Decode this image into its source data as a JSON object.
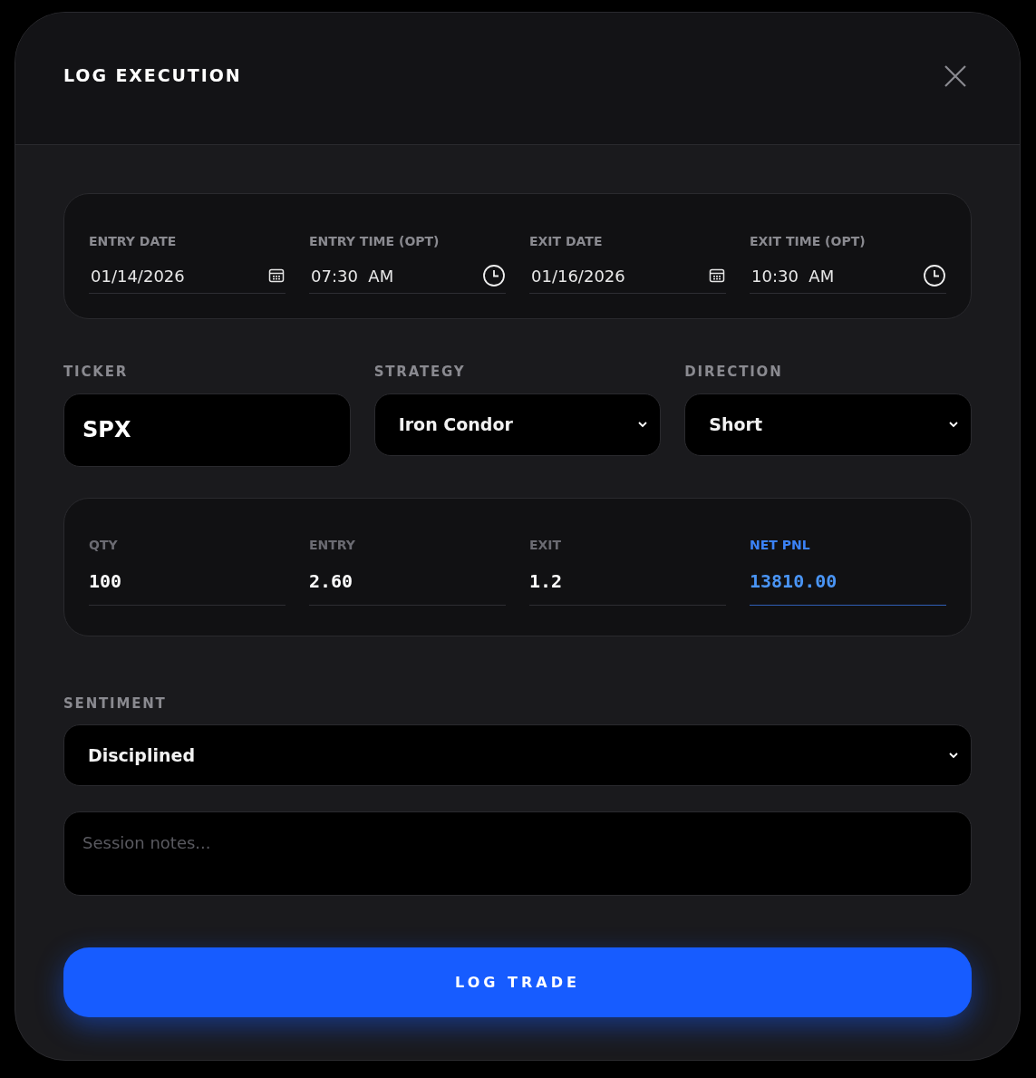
{
  "dialog": {
    "title": "LOG EXECUTION"
  },
  "timing": [
    {
      "label": "ENTRY DATE",
      "value": "01/14/2026",
      "kind": "date"
    },
    {
      "label": "ENTRY TIME (OPT)",
      "value": "07:30  AM",
      "kind": "time"
    },
    {
      "label": "EXIT DATE",
      "value": "01/16/2026",
      "kind": "date"
    },
    {
      "label": "EXIT TIME (OPT)",
      "value": "10:30  AM",
      "kind": "time"
    }
  ],
  "ticker": {
    "label": "TICKER",
    "value": "SPX"
  },
  "strategy": {
    "label": "STRATEGY",
    "value": "Iron Condor"
  },
  "direction": {
    "label": "DIRECTION",
    "value": "Short"
  },
  "figures": [
    {
      "label": "QTY",
      "value": "100",
      "highlighted": false
    },
    {
      "label": "ENTRY",
      "value": "2.60",
      "highlighted": false
    },
    {
      "label": "EXIT",
      "value": "1.2",
      "highlighted": false
    },
    {
      "label": "NET PNL",
      "value": "13810.00",
      "highlighted": true
    }
  ],
  "sentiment": {
    "label": "SENTIMENT",
    "value": "Disciplined"
  },
  "notes": {
    "placeholder": "Session notes..."
  },
  "submit": {
    "label": "LOG TRADE"
  }
}
